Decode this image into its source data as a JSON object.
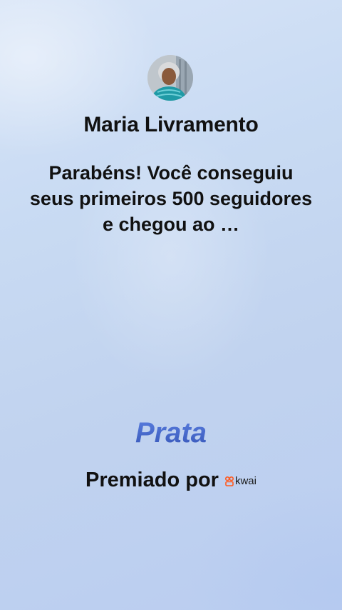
{
  "profile": {
    "avatar_alt": "avatar",
    "name": "Maria Livramento"
  },
  "message": {
    "text": "Parabéns! Você conseguiu seus primeiros 500 seguidores e chegou ao …"
  },
  "achievement": {
    "tier": "Prata",
    "tier_color": "#3b5fc0"
  },
  "awarded": {
    "label": "Premiado por",
    "brand": "kwai",
    "brand_icon": "kwai-logo-icon",
    "brand_color": "#ff5a1f"
  }
}
